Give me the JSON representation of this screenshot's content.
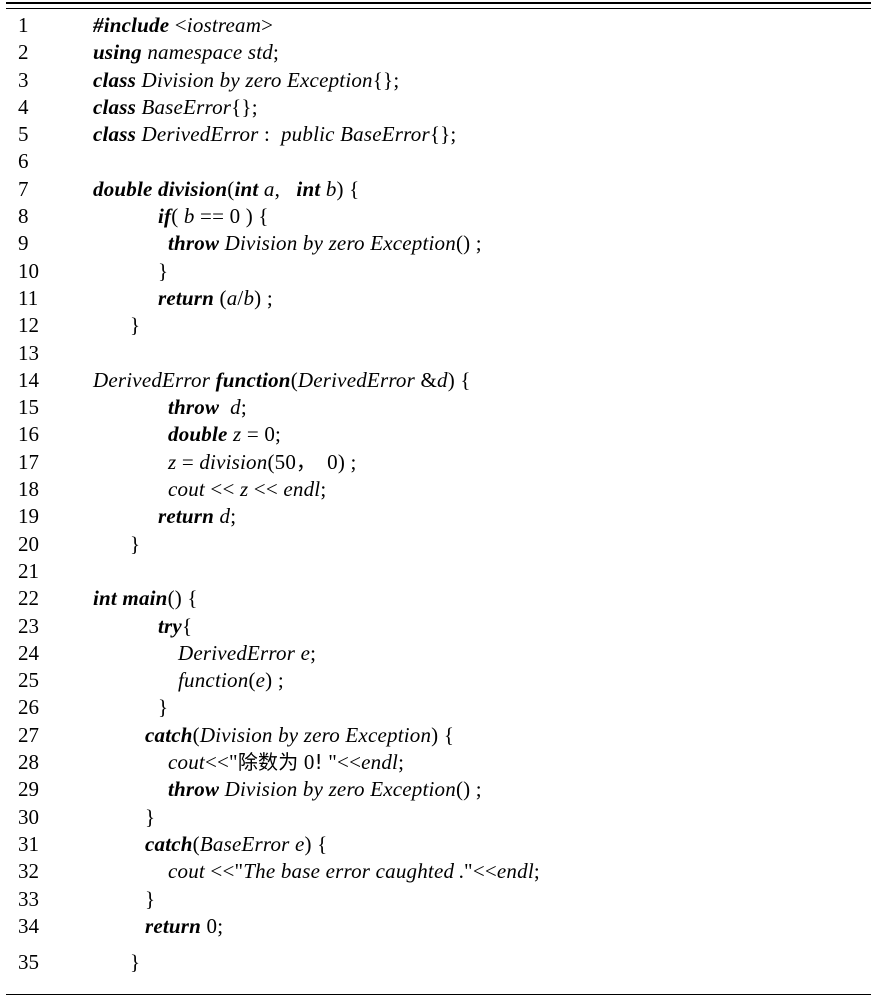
{
  "document": {
    "kind": "code-listing",
    "language": "C++",
    "total_lines": 35,
    "border_top": "double-rule",
    "border_bottom": "single-rule",
    "text_color": "#000000",
    "background_color": "#ffffff"
  },
  "code": {
    "line_numbers": [
      "1",
      "2",
      "3",
      "4",
      "5",
      "6",
      "7",
      "8",
      "9",
      "10",
      "11",
      "12",
      "13",
      "14",
      "15",
      "16",
      "17",
      "18",
      "19",
      "20",
      "21",
      "22",
      "23",
      "24",
      "25",
      "26",
      "27",
      "28",
      "29",
      "30",
      "31",
      "32",
      "33",
      "34",
      "35"
    ],
    "lines": [
      {
        "no": "1",
        "indent": 0,
        "text": "#include <iostream>"
      },
      {
        "no": "2",
        "indent": 0,
        "text": "using namespace std;"
      },
      {
        "no": "3",
        "indent": 0,
        "text": "class Division by zero Exception{};"
      },
      {
        "no": "4",
        "indent": 0,
        "text": "class BaseError{};"
      },
      {
        "no": "5",
        "indent": 0,
        "text": "class DerivedError :  public BaseError{};"
      },
      {
        "no": "6",
        "indent": 0,
        "text": ""
      },
      {
        "no": "7",
        "indent": 0,
        "text": "double division(int a,   int b){"
      },
      {
        "no": "8",
        "indent": 3,
        "text": "if( b == 0 ){"
      },
      {
        "no": "9",
        "indent": 4,
        "text": "throw Division by zero Exception();"
      },
      {
        "no": "10",
        "indent": 3,
        "text": "}"
      },
      {
        "no": "11",
        "indent": 3,
        "text": "return (a/b);"
      },
      {
        "no": "12",
        "indent": 1,
        "text": "}"
      },
      {
        "no": "13",
        "indent": 0,
        "text": ""
      },
      {
        "no": "14",
        "indent": 0,
        "text": "DerivedError function(DerivedError &d){"
      },
      {
        "no": "15",
        "indent": 4,
        "text": "throw d;"
      },
      {
        "no": "16",
        "indent": 4,
        "text": "double z = 0;"
      },
      {
        "no": "17",
        "indent": 4,
        "text": "z = division(50, 0);"
      },
      {
        "no": "18",
        "indent": 4,
        "text": "cout << z << endl;"
      },
      {
        "no": "19",
        "indent": 3,
        "text": "return d;"
      },
      {
        "no": "20",
        "indent": 1,
        "text": "}"
      },
      {
        "no": "21",
        "indent": 0,
        "text": ""
      },
      {
        "no": "22",
        "indent": 0,
        "text": "int main(){"
      },
      {
        "no": "23",
        "indent": 3,
        "text": "try{"
      },
      {
        "no": "24",
        "indent": 5,
        "text": "DerivedError e;"
      },
      {
        "no": "25",
        "indent": 5,
        "text": "function(e);"
      },
      {
        "no": "26",
        "indent": 3,
        "text": "}"
      },
      {
        "no": "27",
        "indent": 2,
        "text": "catch(Division by zero Exception){"
      },
      {
        "no": "28",
        "indent": 4,
        "text": "cout<<\"除数为 0! \"<<endl;"
      },
      {
        "no": "29",
        "indent": 4,
        "text": "throw Division by zero Exception();"
      },
      {
        "no": "30",
        "indent": 2,
        "text": "}"
      },
      {
        "no": "31",
        "indent": 2,
        "text": "catch(BaseError e){"
      },
      {
        "no": "32",
        "indent": 4,
        "text": "cout <<\"The base error caughted.\"<<endl;"
      },
      {
        "no": "33",
        "indent": 2,
        "text": "}"
      },
      {
        "no": "34",
        "indent": 2,
        "text": "return 0;"
      },
      {
        "no": "35",
        "indent": 1,
        "text": "}"
      }
    ],
    "tokens": {
      "keywords": [
        "#include",
        "using",
        "class",
        "public",
        "double",
        "int",
        "if",
        "throw",
        "return",
        "try",
        "catch",
        "main",
        "function"
      ],
      "string_literals": [
        "\"除数为 0! \"",
        "\"The base error caughted.\""
      ],
      "numbers": [
        "0",
        "50"
      ],
      "identifiers": [
        "iostream",
        "namespace",
        "std",
        "Division",
        "by",
        "zero",
        "Exception",
        "BaseError",
        "DerivedError",
        "division",
        "a",
        "b",
        "d",
        "z",
        "e",
        "cout",
        "endl"
      ]
    }
  }
}
